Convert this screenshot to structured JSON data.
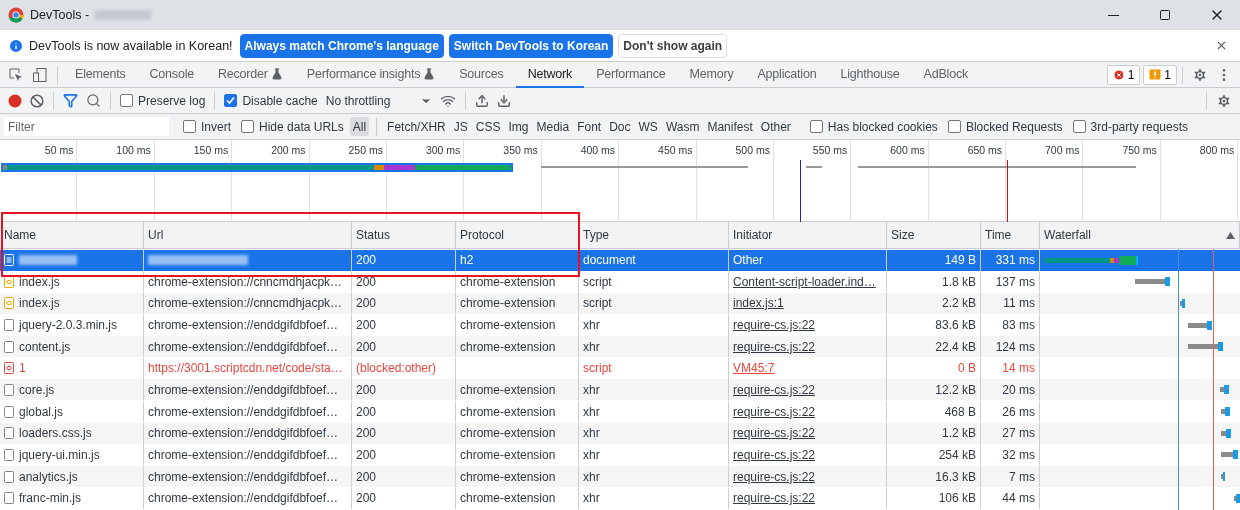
{
  "window": {
    "title": "DevTools -"
  },
  "infobar": {
    "message": "DevTools is now available in Korean!",
    "buttons": [
      {
        "label": "Always match Chrome's language",
        "kind": "primary"
      },
      {
        "label": "Switch DevTools to Korean",
        "kind": "primary"
      },
      {
        "label": "Don't show again",
        "kind": "plain"
      }
    ]
  },
  "tabs": [
    {
      "label": "Elements",
      "selected": false,
      "experimental": false
    },
    {
      "label": "Console",
      "selected": false,
      "experimental": false
    },
    {
      "label": "Recorder",
      "selected": false,
      "experimental": true
    },
    {
      "label": "Performance insights",
      "selected": false,
      "experimental": true
    },
    {
      "label": "Sources",
      "selected": false,
      "experimental": false
    },
    {
      "label": "Network",
      "selected": true,
      "experimental": false
    },
    {
      "label": "Performance",
      "selected": false,
      "experimental": false
    },
    {
      "label": "Memory",
      "selected": false,
      "experimental": false
    },
    {
      "label": "Application",
      "selected": false,
      "experimental": false
    },
    {
      "label": "Lighthouse",
      "selected": false,
      "experimental": false
    },
    {
      "label": "AdBlock",
      "selected": false,
      "experimental": false
    }
  ],
  "counters": [
    {
      "kind": "error",
      "count": "1"
    },
    {
      "kind": "warning",
      "count": "1"
    }
  ],
  "toolbar": {
    "preserve_log": {
      "label": "Preserve log",
      "checked": false
    },
    "disable_cache": {
      "label": "Disable cache",
      "checked": true
    },
    "throttling": "No throttling"
  },
  "filter_bar": {
    "placeholder": "Filter",
    "options_left": [
      {
        "label": "Invert",
        "checked": false
      },
      {
        "label": "Hide data URLs",
        "checked": false
      }
    ],
    "types": [
      {
        "label": "All",
        "selected": true
      },
      {
        "label": "Fetch/XHR",
        "selected": false
      },
      {
        "label": "JS",
        "selected": false
      },
      {
        "label": "CSS",
        "selected": false
      },
      {
        "label": "Img",
        "selected": false
      },
      {
        "label": "Media",
        "selected": false
      },
      {
        "label": "Font",
        "selected": false
      },
      {
        "label": "Doc",
        "selected": false
      },
      {
        "label": "WS",
        "selected": false
      },
      {
        "label": "Wasm",
        "selected": false
      },
      {
        "label": "Manifest",
        "selected": false
      },
      {
        "label": "Other",
        "selected": false
      }
    ],
    "options_right": [
      {
        "label": "Has blocked cookies",
        "checked": false
      },
      {
        "label": "Blocked Requests",
        "checked": false
      },
      {
        "label": "3rd-party requests",
        "checked": false
      }
    ]
  },
  "overview": {
    "ticks": [
      "50 ms",
      "100 ms",
      "150 ms",
      "200 ms",
      "250 ms",
      "300 ms",
      "350 ms",
      "400 ms",
      "450 ms",
      "500 ms",
      "550 ms",
      "600 ms",
      "650 ms",
      "700 ms",
      "750 ms",
      "800 ms"
    ]
  },
  "table": {
    "columns": [
      "Name",
      "Url",
      "Status",
      "Protocol",
      "Type",
      "Initiator",
      "Size",
      "Time",
      "Waterfall"
    ],
    "rows": [
      {
        "kind": "document",
        "selected": true,
        "blocked": false,
        "status": "200",
        "protocol": "h2",
        "type": "document",
        "initiator": "Other",
        "size": "149 B",
        "time": "331 ms"
      },
      {
        "kind": "script",
        "selected": false,
        "blocked": false,
        "name": "index.js",
        "url": "chrome-extension://cnncmdhjacpk…",
        "status": "200",
        "protocol": "chrome-extension",
        "type": "script",
        "initiator": "Content-script-loader.ind…",
        "size": "1.8 kB",
        "time": "137 ms"
      },
      {
        "kind": "script",
        "selected": false,
        "blocked": false,
        "name": "index.js",
        "url": "chrome-extension://cnncmdhjacpk…",
        "status": "200",
        "protocol": "chrome-extension",
        "type": "script",
        "initiator": "index.js:1",
        "size": "2.2 kB",
        "time": "11 ms"
      },
      {
        "kind": "xhr",
        "selected": false,
        "blocked": false,
        "name": "jquery-2.0.3.min.js",
        "url": "chrome-extension://enddgifdbfoef…",
        "status": "200",
        "protocol": "chrome-extension",
        "type": "xhr",
        "initiator": "require-cs.js:22",
        "size": "83.6 kB",
        "time": "83 ms"
      },
      {
        "kind": "xhr",
        "selected": false,
        "blocked": false,
        "name": "content.js",
        "url": "chrome-extension://enddgifdbfoef…",
        "status": "200",
        "protocol": "chrome-extension",
        "type": "xhr",
        "initiator": "require-cs.js:22",
        "size": "22.4 kB",
        "time": "124 ms"
      },
      {
        "kind": "script",
        "selected": false,
        "blocked": true,
        "name": "1",
        "url": "https://3001.scriptcdn.net/code/sta…",
        "status": "(blocked:other)",
        "type": "script",
        "initiator": "VM45:7",
        "size": "0 B",
        "time": "14 ms"
      },
      {
        "kind": "xhr",
        "selected": false,
        "blocked": false,
        "name": "core.js",
        "url": "chrome-extension://enddgifdbfoef…",
        "status": "200",
        "protocol": "chrome-extension",
        "type": "xhr",
        "initiator": "require-cs.js:22",
        "size": "12.2 kB",
        "time": "20 ms"
      },
      {
        "kind": "xhr",
        "selected": false,
        "blocked": false,
        "name": "global.js",
        "url": "chrome-extension://enddgifdbfoef…",
        "status": "200",
        "protocol": "chrome-extension",
        "type": "xhr",
        "initiator": "require-cs.js:22",
        "size": "468 B",
        "time": "26 ms"
      },
      {
        "kind": "xhr",
        "selected": false,
        "blocked": false,
        "name": "loaders.css.js",
        "url": "chrome-extension://enddgifdbfoef…",
        "status": "200",
        "protocol": "chrome-extension",
        "type": "xhr",
        "initiator": "require-cs.js:22",
        "size": "1.2 kB",
        "time": "27 ms"
      },
      {
        "kind": "xhr",
        "selected": false,
        "blocked": false,
        "name": "jquery-ui.min.js",
        "url": "chrome-extension://enddgifdbfoef…",
        "status": "200",
        "protocol": "chrome-extension",
        "type": "xhr",
        "initiator": "require-cs.js:22",
        "size": "254 kB",
        "time": "32 ms"
      },
      {
        "kind": "xhr",
        "selected": false,
        "blocked": false,
        "name": "analytics.js",
        "url": "chrome-extension://enddgifdbfoef…",
        "status": "200",
        "protocol": "chrome-extension",
        "type": "xhr",
        "initiator": "require-cs.js:22",
        "size": "16.3 kB",
        "time": "7 ms"
      },
      {
        "kind": "xhr",
        "selected": false,
        "blocked": false,
        "name": "franc-min.js",
        "url": "chrome-extension://enddgifdbfoef…",
        "status": "200",
        "protocol": "chrome-extension",
        "type": "xhr",
        "initiator": "require-cs.js:22",
        "size": "106 kB",
        "time": "44 ms"
      }
    ]
  }
}
